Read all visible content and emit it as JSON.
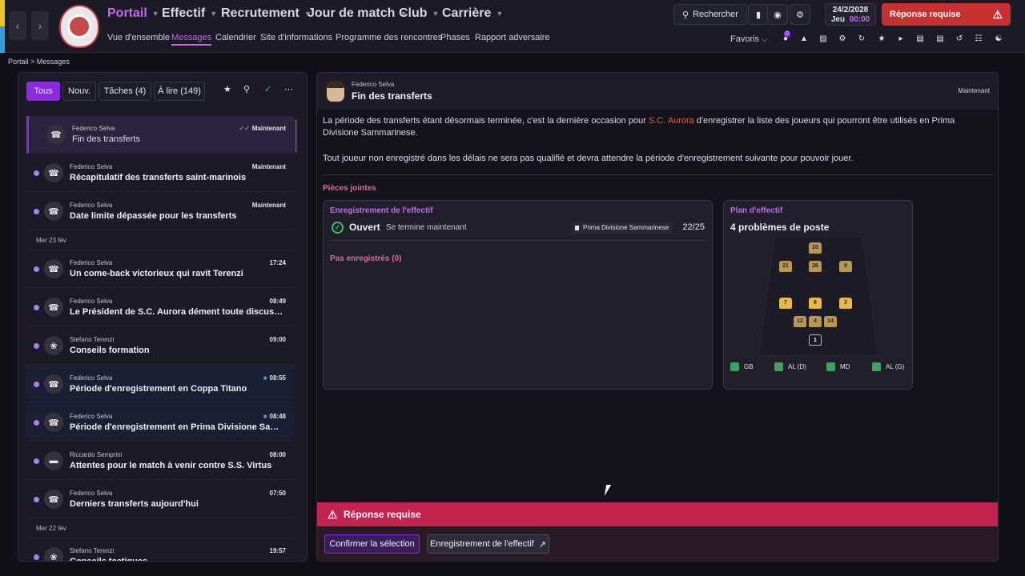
{
  "topbar": {
    "menus": [
      {
        "label": "Portail",
        "active": true
      },
      {
        "label": "Effectif"
      },
      {
        "label": "Recrutement"
      },
      {
        "label": "Jour de match"
      },
      {
        "label": "Club"
      },
      {
        "label": "Carrière"
      }
    ],
    "subnav": [
      "Vue d'ensemble",
      "Messages",
      "Calendrier",
      "Site d'informations",
      "Programme des rencontres",
      "Phases",
      "Rapport adversaire"
    ],
    "search_label": "Rechercher",
    "date": "24/2/2028",
    "day": "Jeu",
    "time": "00:00",
    "response_button": "Réponse requise",
    "favoris": "Favoris",
    "badge": "0"
  },
  "breadcrumb": [
    "Portail",
    "Messages"
  ],
  "filters": [
    {
      "label": "Tous",
      "active": true
    },
    {
      "label": "Nouv."
    },
    {
      "label": "Tâches (4)"
    },
    {
      "label": "À lire (149)"
    }
  ],
  "inbox": {
    "day_headers": [
      "Mer 23 fév",
      "Mer 22 fév"
    ],
    "messages": [
      {
        "from": "Federico Selva",
        "subject": "Fin des transferts",
        "time": "Maintenant",
        "selected": true,
        "read_check": true
      },
      {
        "from": "Federico Selva",
        "subject": "Récapitulatif des transferts saint-marinois",
        "time": "Maintenant",
        "unread": true
      },
      {
        "from": "Federico Selva",
        "subject": "Date limite dépassée pour les transferts",
        "time": "Maintenant",
        "unread": true
      },
      {
        "from": "Federico Selva",
        "subject": "Un come-back victorieux qui ravit Terenzi",
        "time": "17:24",
        "unread": true
      },
      {
        "from": "Federico Selva",
        "subject": "Le Président de S.C. Aurora dément toute discussion",
        "time": "08:49",
        "unread": true
      },
      {
        "from": "Stefano Terenzi",
        "subject": "Conseils formation",
        "time": "09:00",
        "unread": true
      },
      {
        "from": "Federico Selva",
        "subject": "Période d'enregistrement en Coppa Titano",
        "time": "08:55",
        "unread": true,
        "comment": true
      },
      {
        "from": "Federico Selva",
        "subject": "Période d'enregistrement en Prima Divisione Sammarinese",
        "time": "08:48",
        "unread": true,
        "comment": true
      },
      {
        "from": "Riccardo Semprini",
        "subject": "Attentes pour le match à venir contre S.S. Virtus",
        "time": "08:00",
        "unread": true
      },
      {
        "from": "Federico Selva",
        "subject": "Derniers transferts aujourd'hui",
        "time": "07:50",
        "unread": true
      },
      {
        "from": "Stefano Terenzi",
        "subject": "Conseils tactiques",
        "time": "19:57",
        "unread": true
      }
    ]
  },
  "detail": {
    "from": "Federico Selva",
    "subject": "Fin des transferts",
    "time": "Maintenant",
    "para1_before": "La période des transferts étant désormais terminée, c'est la dernière occasion pour ",
    "para1_highlight": "S.C. Aurora",
    "para1_after": " d'enregistrer la liste des joueurs qui pourront être utilisés en Prima Divisione Sammarinese.",
    "para2": "Tout joueur non enregistré dans les délais ne sera pas qualifié et devra attendre la période d'enregistrement suivante pour pouvoir jouer.",
    "attachments_label": "Pièces jointes",
    "card1": {
      "title": "Enregistrement de l'effectif",
      "status": "Ouvert",
      "ends": "Se termine maintenant",
      "league": "Prima Divisione Sammarinese",
      "count": "22/25",
      "not_registered": "Pas enregistrés (0)"
    },
    "card2": {
      "title": "Plan d'effectif",
      "problems": "4 problèmes de poste",
      "shirts": [
        "20",
        "21",
        "26",
        "9",
        "7",
        "8",
        "3",
        "12",
        "4",
        "14",
        "1"
      ],
      "legend": [
        "GB",
        "AL (D)",
        "MD",
        "AL (G)"
      ]
    },
    "response_bar": "Réponse requise",
    "confirm_button": "Confirmer la sélection",
    "squad_button": "Enregistrement de l'effectif"
  },
  "colors": {
    "accent": "#8a2be2",
    "highlight": "#e8622f",
    "response": "#c3234f",
    "ok": "#3fbf5f"
  }
}
